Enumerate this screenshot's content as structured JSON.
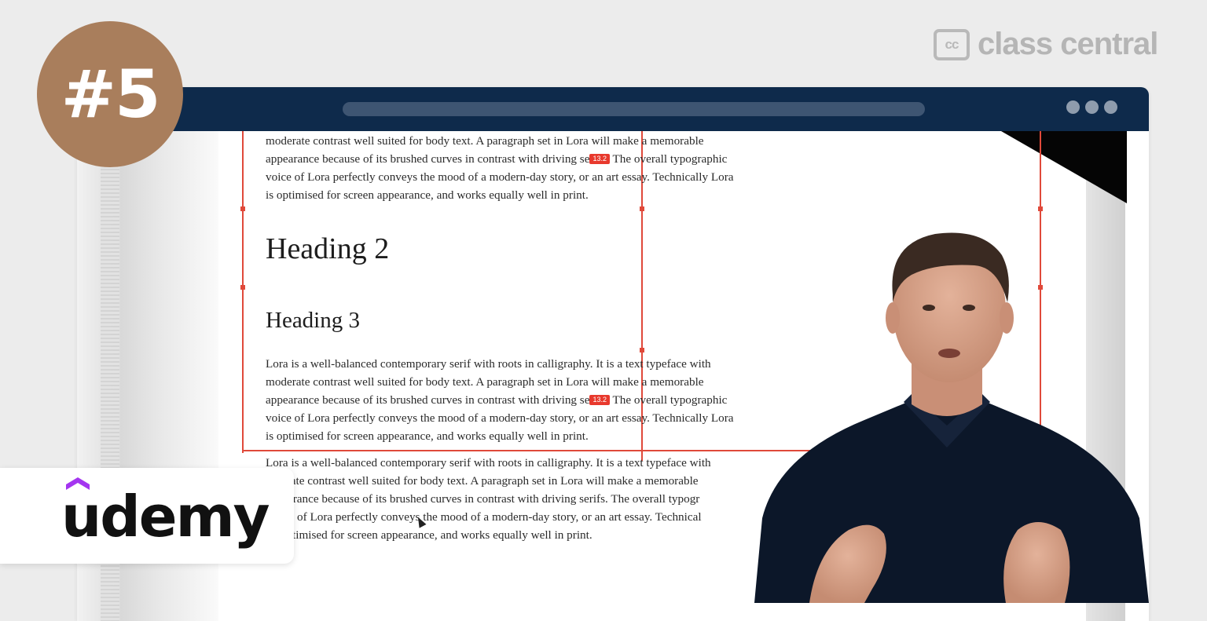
{
  "overlay": {
    "rank": "#5",
    "brand_watermark_icon": "cc",
    "brand_watermark": "class central",
    "provider_logo": "udemy"
  },
  "document": {
    "top_para_lines": [
      "moderate contrast well suited for body text. A paragraph set in Lora will make a memorable",
      "appearance because of its brushed curves in contrast with driving se",
      "voice of Lora perfectly conveys the mood of a modern-day story, or an art essay. Technically Lora",
      "is optimised for screen appearance, and works equally well in print."
    ],
    "top_para_line2_tail": "The overall typographic",
    "heading2": "Heading 2",
    "heading3": "Heading 3",
    "middle_para_lines": [
      "Lora is a well-balanced contemporary serif with roots in calligraphy. It is a text typeface with",
      "moderate contrast well suited for body text. A paragraph set in Lora will make a memorable",
      "appearance because of its brushed curves in contrast with driving se",
      "voice of Lora perfectly conveys the mood of a modern-day story, or an art essay. Technically Lora",
      "is optimised for screen appearance, and works equally well in print."
    ],
    "middle_para_line3_tail": "The overall typographic",
    "bottom_para_lines": [
      "Lora is a well-balanced contemporary serif with roots in calligraphy. It is a text typeface with",
      "erate contrast well suited for body text. A paragraph set in Lora will make a memorable",
      "arance because of its brushed curves in contrast with driving serifs. The overall typogr",
      "of Lora perfectly conveys the mood of a modern-day story, or an art essay. Technical",
      "timised for screen appearance, and works equally well in print."
    ],
    "width_badge": "13.2"
  },
  "colors": {
    "titlebar": "#0e2a4b",
    "rank_badge": "#a97e5c",
    "grid_lines": "#e0493a",
    "udemy_purple": "#a435f0"
  }
}
